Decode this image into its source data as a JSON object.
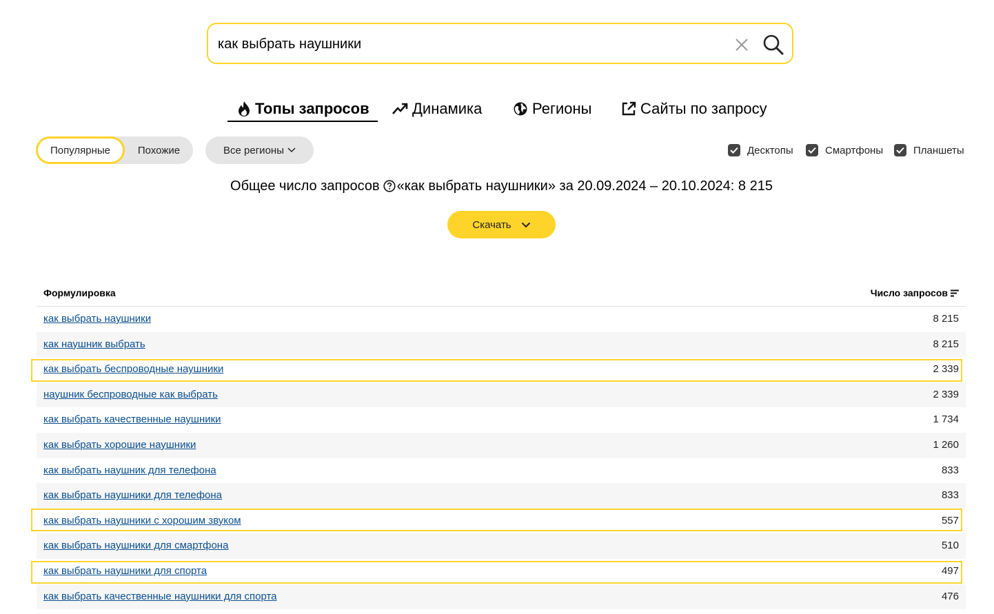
{
  "search": {
    "value": "как выбрать наушники"
  },
  "tabs": [
    {
      "label": "Топы запросов",
      "icon": "fire-icon"
    },
    {
      "label": "Динамика",
      "icon": "trend-icon"
    },
    {
      "label": "Регионы",
      "icon": "globe-icon"
    },
    {
      "label": "Сайты по запросу",
      "icon": "external-link-icon"
    }
  ],
  "filters": {
    "popular": "Популярные",
    "similar": "Похожие",
    "region": "Все регионы",
    "desktops": "Десктопы",
    "smartphones": "Смартфоны",
    "tablets": "Планшеты"
  },
  "summary": {
    "prefix": "Общее число запросов",
    "text": "«как выбрать наушники» за 20.09.2024 – 20.10.2024: 8 215"
  },
  "download_label": "Скачать",
  "table": {
    "col_phrase": "Формулировка",
    "col_count": "Число запросов",
    "rows": [
      {
        "phrase": "как выбрать наушники",
        "count": "8 215"
      },
      {
        "phrase": "как наушник выбрать",
        "count": "8 215"
      },
      {
        "phrase": "как выбрать беспроводные наушники",
        "count": "2 339"
      },
      {
        "phrase": "наушник беспроводные как выбрать",
        "count": "2 339"
      },
      {
        "phrase": "как выбрать качественные наушники",
        "count": "1 734"
      },
      {
        "phrase": "как выбрать хорошие наушники",
        "count": "1 260"
      },
      {
        "phrase": "как выбрать наушник для телефона",
        "count": "833"
      },
      {
        "phrase": "как выбрать наушники для телефона",
        "count": "833"
      },
      {
        "phrase": "как выбрать наушники с хорошим звуком",
        "count": "557"
      },
      {
        "phrase": "как выбрать наушники для смартфона",
        "count": "510"
      },
      {
        "phrase": "как выбрать наушники для спорта",
        "count": "497"
      },
      {
        "phrase": "как выбрать качественные наушники для спорта",
        "count": "476"
      }
    ]
  },
  "colors": {
    "accent": "#fed42b",
    "link": "#0b4f8f",
    "pill": "#e5e5e5"
  }
}
